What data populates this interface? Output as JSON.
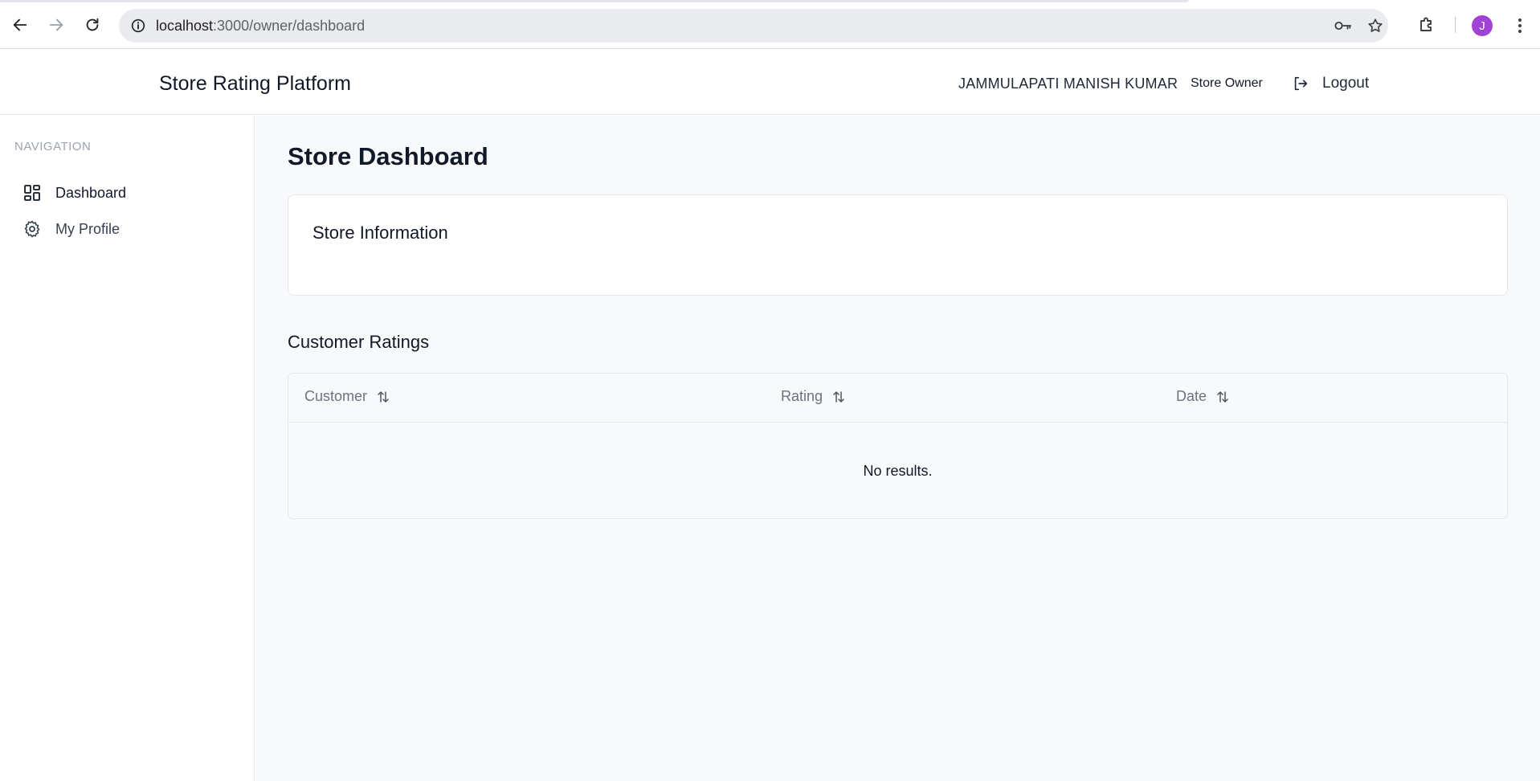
{
  "browser": {
    "url_host": "localhost",
    "url_path": ":3000/owner/dashboard",
    "avatar_letter": "J",
    "avatar_color": "#a142d6"
  },
  "header": {
    "brand": "Store Rating Platform",
    "user_name": "JAMMULAPATI MANISH KUMAR",
    "role": "Store Owner",
    "logout_label": "Logout"
  },
  "sidebar": {
    "heading": "NAVIGATION",
    "items": [
      {
        "label": "Dashboard",
        "icon": "layout-grid-icon",
        "active": true
      },
      {
        "label": "My Profile",
        "icon": "gear-icon",
        "active": false
      }
    ]
  },
  "main": {
    "title": "Store Dashboard",
    "store_info": {
      "title": "Store Information"
    },
    "ratings": {
      "title": "Customer Ratings",
      "columns": [
        "Customer",
        "Rating",
        "Date"
      ],
      "empty_text": "No results."
    }
  }
}
